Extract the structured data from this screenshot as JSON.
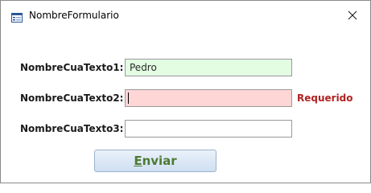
{
  "window": {
    "title": "NombreFormulario",
    "icon": "form-icon",
    "close_icon": "close-icon"
  },
  "form": {
    "fields": [
      {
        "label": "NombreCuaTexto1:",
        "value": "Pedro",
        "state": "valid"
      },
      {
        "label": "NombreCuaTexto2:",
        "value": "",
        "state": "invalid",
        "message": "Requerido"
      },
      {
        "label": "NombreCuaTexto3:",
        "value": "",
        "state": "neutral"
      }
    ],
    "submit": {
      "mnemonic": "E",
      "rest": "nviar"
    }
  },
  "colors": {
    "valid_bg": "#e2fde2",
    "invalid_bg": "#ffd6d6",
    "error_text": "#b22222",
    "button_text": "#4d7a32"
  }
}
